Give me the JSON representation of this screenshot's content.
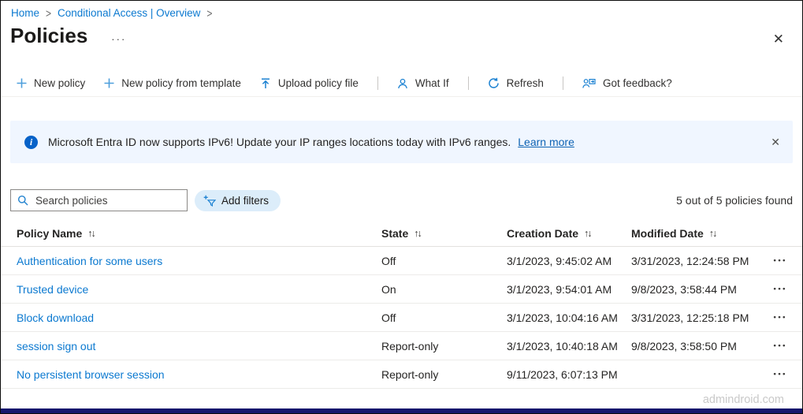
{
  "breadcrumb": {
    "separator": ">",
    "items": [
      {
        "label": "Home"
      },
      {
        "label": "Conditional Access | Overview"
      }
    ]
  },
  "header": {
    "title": "Policies",
    "more_label": "···",
    "close_icon": "✕"
  },
  "toolbar": {
    "items": [
      {
        "icon": "plus-icon",
        "label": "New policy"
      },
      {
        "icon": "plus-icon",
        "label": "New policy from template"
      },
      {
        "icon": "upload-icon",
        "label": "Upload policy file"
      },
      {
        "icon": "person-icon",
        "label": "What If"
      },
      {
        "icon": "refresh-icon",
        "label": "Refresh"
      },
      {
        "icon": "feedback-icon",
        "label": "Got feedback?"
      }
    ]
  },
  "banner": {
    "info_icon": "i",
    "text": "Microsoft Entra ID now supports IPv6! Update your IP ranges locations today with IPv6 ranges.",
    "link_label": "Learn more",
    "close_icon": "✕"
  },
  "filters": {
    "search_placeholder": "Search policies",
    "add_filters_label": "Add filters",
    "result_count": "5 out of 5 policies found"
  },
  "table": {
    "sort_icon": "↑↓",
    "more_icon": "•••",
    "columns": [
      "Policy Name",
      "State",
      "Creation Date",
      "Modified Date"
    ],
    "rows": [
      {
        "name": "Authentication for some users",
        "state": "Off",
        "created": "3/1/2023, 9:45:02 AM",
        "modified": "3/31/2023, 12:24:58 PM"
      },
      {
        "name": "Trusted device",
        "state": "On",
        "created": "3/1/2023, 9:54:01 AM",
        "modified": "9/8/2023, 3:58:44 PM"
      },
      {
        "name": "Block download",
        "state": "Off",
        "created": "3/1/2023, 10:04:16 AM",
        "modified": "3/31/2023, 12:25:18 PM"
      },
      {
        "name": "session sign out",
        "state": "Report-only",
        "created": "3/1/2023, 10:40:18 AM",
        "modified": "9/8/2023, 3:58:50 PM"
      },
      {
        "name": "No persistent browser session",
        "state": "Report-only",
        "created": "9/11/2023, 6:07:13 PM",
        "modified": ""
      }
    ]
  },
  "watermark": "admindroid.com",
  "colors": {
    "accent": "#0b79d0",
    "banner_bg": "#f0f6ff",
    "pill_bg": "#dcedfa",
    "text": "#323130",
    "divider": "#ecebe9",
    "bottom_bar": "#17176d"
  }
}
